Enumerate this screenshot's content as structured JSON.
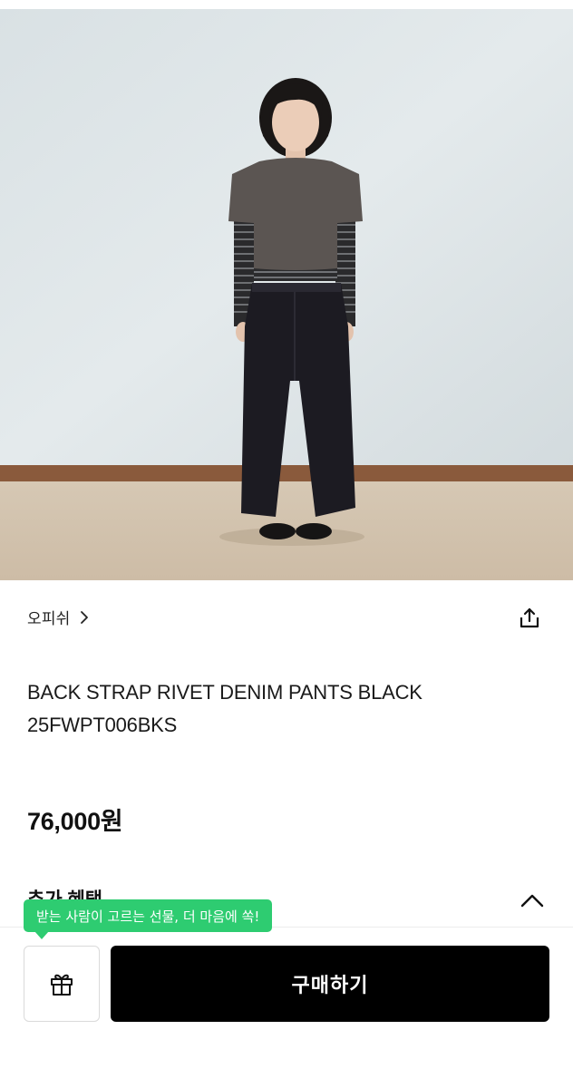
{
  "product": {
    "brand": "오피쉬",
    "title_line1": "BACK STRAP RIVET DENIM PANTS BLACK",
    "title_line2": "25FWPT006BKS",
    "price": "76,000원",
    "photo_icon": "product-photo"
  },
  "benefits": {
    "label": "추가 혜택",
    "toggle_icon": "chevron-up-icon"
  },
  "actions": {
    "share_icon": "share-icon",
    "gift_icon": "gift-icon",
    "buy_label": "구매하기",
    "gift_tooltip": "받는 사람이 고르는 선물, 더 마음에 쏙!"
  },
  "colors": {
    "tooltip": "#2ecc71",
    "buy_button": "#000000",
    "text": "#111111"
  }
}
